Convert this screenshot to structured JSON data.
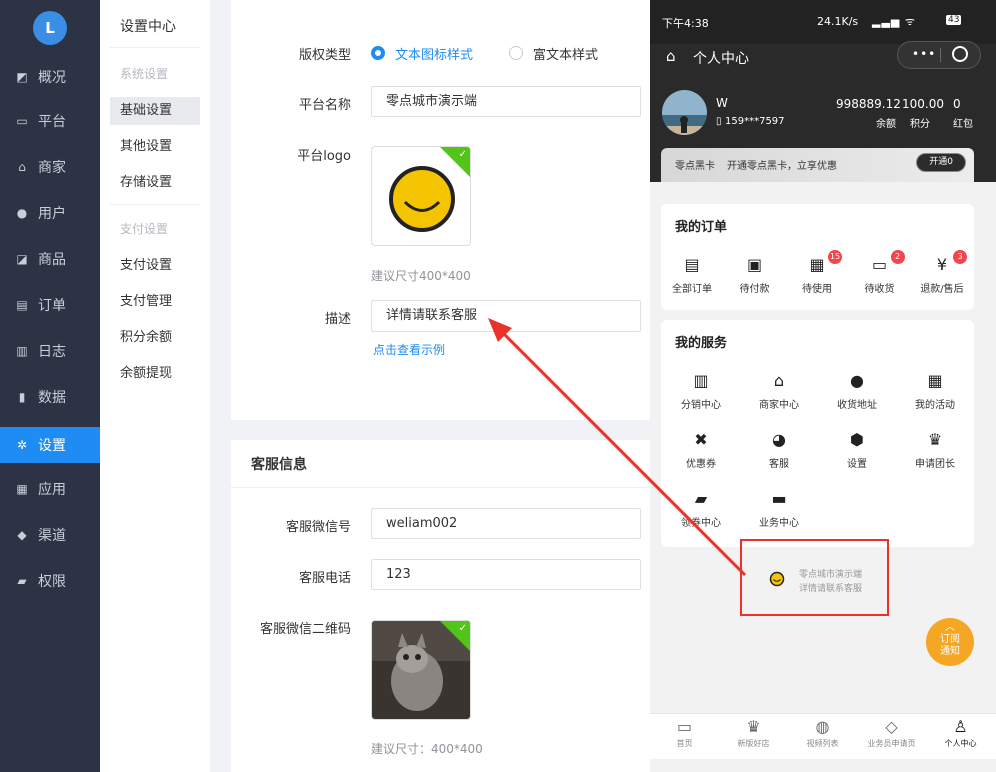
{
  "nav": {
    "logo": "L",
    "items": [
      {
        "label": "概况",
        "icon": "dashboard-icon",
        "glyph": "◩"
      },
      {
        "label": "平台",
        "icon": "monitor-icon",
        "glyph": "▭"
      },
      {
        "label": "商家",
        "icon": "store-icon",
        "glyph": "⌂"
      },
      {
        "label": "用户",
        "icon": "user-icon",
        "glyph": "●"
      },
      {
        "label": "商品",
        "icon": "goods-icon",
        "glyph": "◪"
      },
      {
        "label": "订单",
        "icon": "order-icon",
        "glyph": "▤"
      },
      {
        "label": "日志",
        "icon": "book-icon",
        "glyph": "▥"
      },
      {
        "label": "数据",
        "icon": "chart-icon",
        "glyph": "▮"
      },
      {
        "label": "设置",
        "icon": "gear-icon",
        "glyph": "✲"
      },
      {
        "label": "应用",
        "icon": "apps-icon",
        "glyph": "▦"
      },
      {
        "label": "渠道",
        "icon": "cube-icon",
        "glyph": "◆"
      },
      {
        "label": "权限",
        "icon": "lock-icon",
        "glyph": "▰"
      }
    ]
  },
  "subnav": {
    "title": "设置中心",
    "group1": "系统设置",
    "items1": [
      "基础设置",
      "其他设置",
      "存储设置"
    ],
    "group2": "支付设置",
    "items2": [
      "支付设置",
      "支付管理",
      "积分余额",
      "余额提现"
    ]
  },
  "form": {
    "copyright_label": "版权类型",
    "copyright_opt1": "文本图标样式",
    "copyright_opt2": "富文本样式",
    "platform_name_label": "平台名称",
    "platform_name_value": "零点城市演示端",
    "logo_label": "平台logo",
    "logo_hint": "建议尺寸400*400",
    "desc_label": "描述",
    "desc_value": "详情请联系客服",
    "example_link": "点击查看示例"
  },
  "service": {
    "section_title": "客服信息",
    "wechat_label": "客服微信号",
    "wechat_value": "weliam002",
    "phone_label": "客服电话",
    "phone_value": "123",
    "qr_label": "客服微信二维码",
    "qr_hint": "建议尺寸：400*400"
  },
  "phone": {
    "status_time": "下午4:38",
    "status_right": "24.1K/s",
    "battery": "43",
    "title": "个人中心",
    "user_name": "W",
    "user_phone": "159***7597",
    "stats": [
      {
        "value": "998889.12",
        "label": "余额"
      },
      {
        "value": "100.00",
        "label": "积分"
      },
      {
        "value": "0",
        "label": "红包"
      }
    ],
    "vip_title": "零点黑卡",
    "vip_text": "开通零点黑卡，立享优惠",
    "vip_button": "开通0",
    "orders_title": "我的订单",
    "orders": [
      {
        "label": "全部订单",
        "glyph": "▤",
        "badge": ""
      },
      {
        "label": "待付款",
        "glyph": "▣",
        "badge": ""
      },
      {
        "label": "待使用",
        "glyph": "▦",
        "badge": "15"
      },
      {
        "label": "待收货",
        "glyph": "▭",
        "badge": "2"
      },
      {
        "label": "退款/售后",
        "glyph": "¥",
        "badge": "3"
      }
    ],
    "services_title": "我的服务",
    "services": [
      {
        "label": "分销中心",
        "glyph": "▥"
      },
      {
        "label": "商家中心",
        "glyph": "⌂"
      },
      {
        "label": "收货地址",
        "glyph": "●"
      },
      {
        "label": "我的活动",
        "glyph": "▦"
      },
      {
        "label": "优惠券",
        "glyph": "✖"
      },
      {
        "label": "客服",
        "glyph": "◕"
      },
      {
        "label": "设置",
        "glyph": "⬢"
      },
      {
        "label": "申请团长",
        "glyph": "♛"
      },
      {
        "label": "领券中心",
        "glyph": "▰"
      },
      {
        "label": "业务中心",
        "glyph": "▬"
      }
    ],
    "footer_line1": "零点城市演示端",
    "footer_line2": "详情请联系客服",
    "subscribe": "订阅通知",
    "tabs": [
      "首页",
      "新版好店",
      "视频列表",
      "业务员申请页",
      "个人中心"
    ]
  },
  "colors": {
    "accent": "#1e8cf3",
    "nav_bg": "#2b3344",
    "badge": "#f2454c",
    "annotation": "#e8322b",
    "subscribe": "#f5a623"
  }
}
